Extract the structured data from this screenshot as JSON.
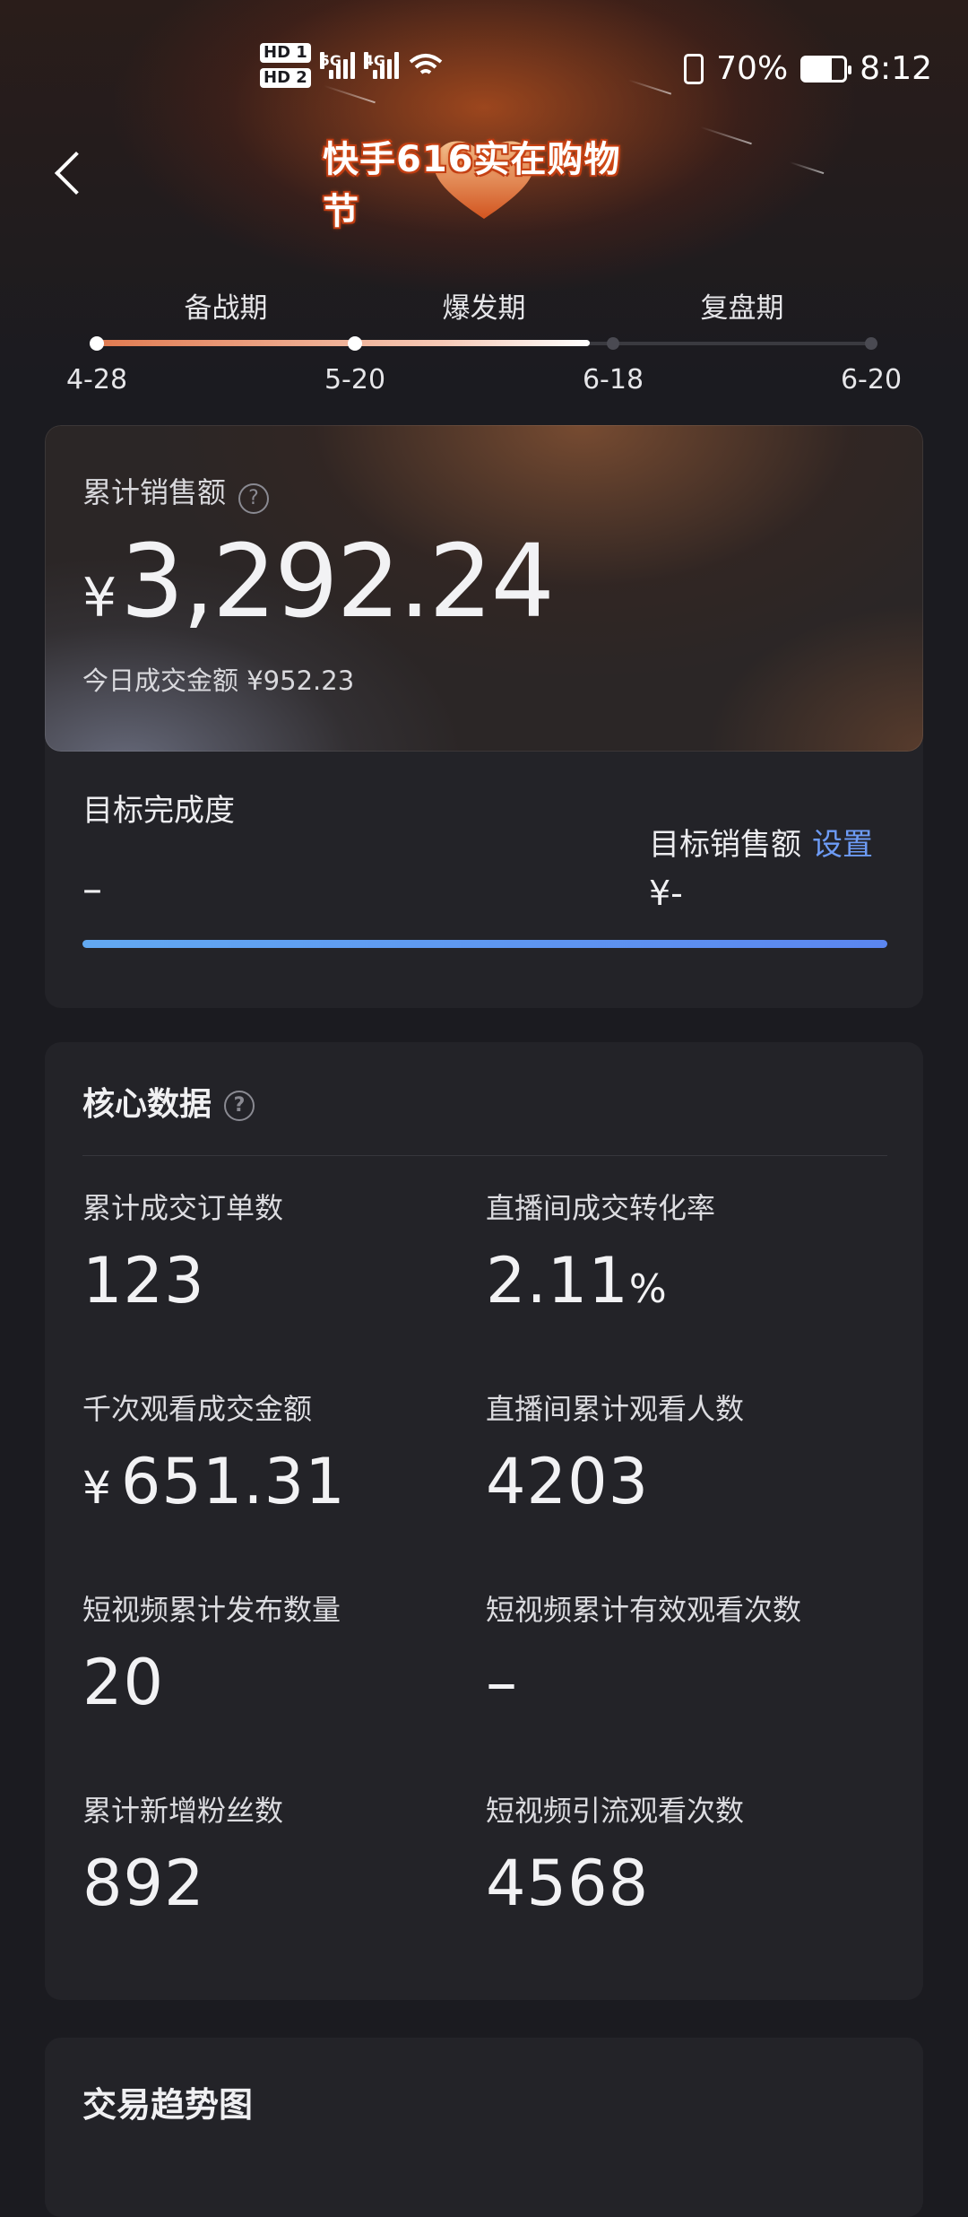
{
  "status_bar": {
    "hd1": "HD 1",
    "hd2": "HD 2",
    "net1": "5G",
    "net2": "4G",
    "battery_text": "70%",
    "time": "8:12"
  },
  "header": {
    "title": "快手616实在购物节",
    "colors": {
      "accent": "#e2601f"
    }
  },
  "timeline": {
    "phases": [
      "备战期",
      "爆发期",
      "复盘期"
    ],
    "dates": [
      "4-28",
      "5-20",
      "6-18",
      "6-20"
    ],
    "progress_fraction": 0.61
  },
  "sales": {
    "label": "累计销售额",
    "currency": "¥",
    "amount": "3,292.24",
    "today": "今日成交金额 ¥952.23",
    "goal_label": "目标完成度",
    "goal_value": "–",
    "target_label": "目标销售额",
    "target_set": "设置",
    "target_value": "¥-"
  },
  "core": {
    "title": "核心数据",
    "metrics": [
      {
        "label": "累计成交订单数",
        "value": "123"
      },
      {
        "label": "直播间成交转化率",
        "value": "2.11",
        "unit": "%"
      },
      {
        "label": "千次观看成交金额",
        "currency": "¥",
        "value": "651.31"
      },
      {
        "label": "直播间累计观看人数",
        "value": "4203"
      },
      {
        "label": "短视频累计发布数量",
        "value": "20"
      },
      {
        "label": "短视频累计有效观看次数",
        "value": "–"
      },
      {
        "label": "累计新增粉丝数",
        "value": "892"
      },
      {
        "label": "短视频引流观看次数",
        "value": "4568"
      }
    ]
  },
  "trend": {
    "title": "交易趋势图"
  }
}
